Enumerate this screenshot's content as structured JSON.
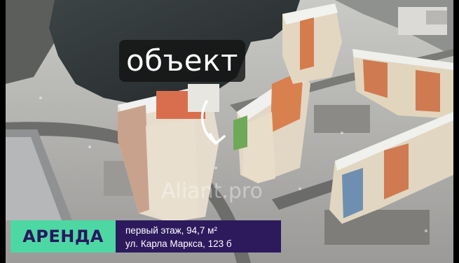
{
  "overlay": {
    "object_label": "объект",
    "watermark": "Aliant.pro"
  },
  "banner": {
    "badge": "АРЕНДА",
    "line1": "первый этаж, 94,7 м²",
    "line2": "ул. Карла Маркса, 123 б"
  },
  "colors": {
    "badge_bg": "#4dd8a3",
    "badge_text": "#2a1660",
    "info_bg": "#2c1a5d",
    "pointer": "#ffffff"
  },
  "icons": {
    "pointer": "pointer-arrow-icon"
  }
}
